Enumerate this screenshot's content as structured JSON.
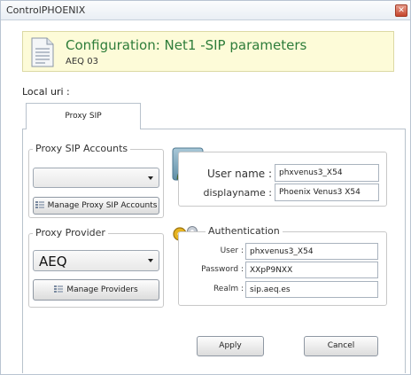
{
  "window": {
    "title": "ControlPHOENIX"
  },
  "banner": {
    "title": "Configuration: Net1 -SIP parameters",
    "subtitle": "AEQ 03"
  },
  "local_uri_label": "Local uri :",
  "tabs": [
    {
      "label": "Proxy SIP"
    }
  ],
  "proxy_accounts": {
    "label": "Proxy SIP Accounts",
    "selected": "",
    "manage_button": "Manage Proxy SIP Accounts"
  },
  "proxy_provider": {
    "label": "Proxy Provider",
    "selected": "AEQ",
    "manage_button": "Manage Providers"
  },
  "identity": {
    "user_name_label": "User name :",
    "user_name_value": "phxvenus3_X54",
    "displayname_label": "displayname :",
    "displayname_value": "Phoenix Venus3 X54"
  },
  "authentication": {
    "label": "Authentication",
    "user_label": "User :",
    "user_value": "phxvenus3_X54",
    "password_label": "Password :",
    "password_value": "XXpP9NXX",
    "realm_label": "Realm :",
    "realm_value": "sip.aeq.es"
  },
  "buttons": {
    "apply": "Apply",
    "cancel": "Cancel"
  },
  "colors": {
    "banner_bg": "#fdfbd8",
    "banner_title": "#2e7d3a",
    "close_button": "#c5442c"
  },
  "icons": [
    "close-icon",
    "document-icon",
    "user-avatar-icon",
    "keys-icon",
    "list-icon",
    "chevron-down-icon"
  ]
}
